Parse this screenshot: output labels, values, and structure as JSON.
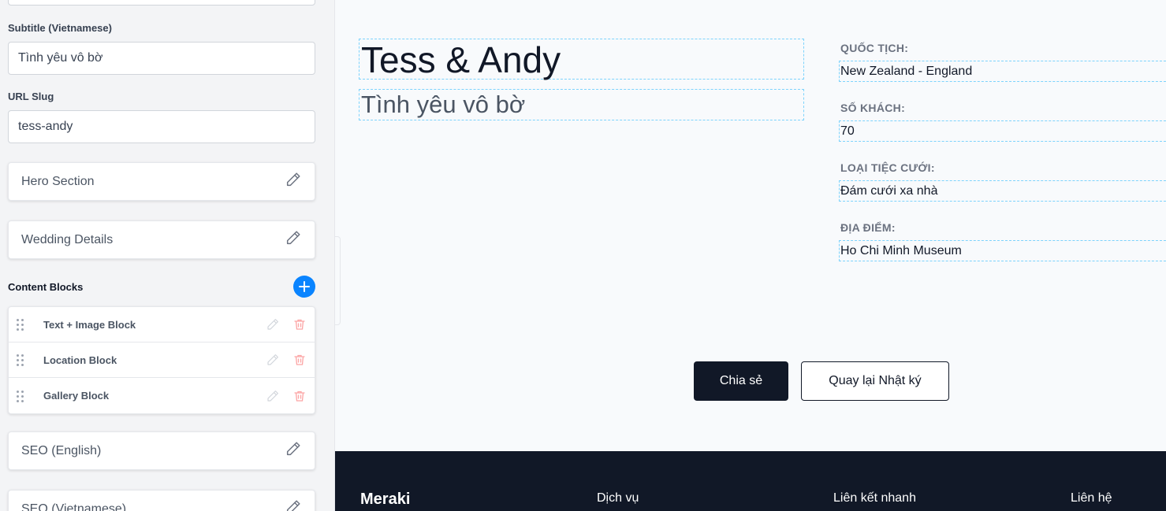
{
  "sidebar": {
    "subtitle_vi": {
      "label": "Subtitle (Vietnamese)",
      "value": "Tình yêu vô bờ"
    },
    "url_slug": {
      "label": "URL Slug",
      "value": "tess-andy"
    },
    "sections": [
      {
        "label": "Hero Section",
        "icon": "pencil-icon"
      },
      {
        "label": "Wedding Details",
        "icon": "pencil-icon"
      }
    ],
    "content_blocks": {
      "title": "Content Blocks",
      "add_icon": "plus-icon",
      "blocks": [
        {
          "label": "Text + Image Block"
        },
        {
          "label": "Location Block"
        },
        {
          "label": "Gallery Block"
        }
      ]
    },
    "seo_sections": [
      {
        "label": "SEO (English)",
        "icon": "pencil-icon"
      },
      {
        "label": "SEO (Vietnamese)",
        "icon": "pencil-icon"
      }
    ]
  },
  "preview": {
    "title": "Tess & Andy",
    "subtitle": "Tình yêu vô bờ",
    "details": [
      {
        "label": "QUỐC TỊCH:",
        "value": "New Zealand - England"
      },
      {
        "label": "SỐ KHÁCH:",
        "value": "70"
      },
      {
        "label": "LOẠI TIỆC CƯỚI:",
        "value": "Đám cưới xa nhà"
      },
      {
        "label": "ĐỊA ĐIỂM:",
        "value": "Ho Chi Minh Museum"
      }
    ],
    "share_button": "Chia sẻ",
    "back_button": "Quay lại Nhật ký"
  },
  "footer": {
    "brand": "Meraki",
    "columns": [
      "Dịch vụ",
      "Liên kết nhanh",
      "Liên hệ"
    ]
  },
  "colors": {
    "accent": "#0a84ff",
    "dark": "#111827",
    "delete": "#fca5a5",
    "editable_outline": "#7dd3fc"
  }
}
